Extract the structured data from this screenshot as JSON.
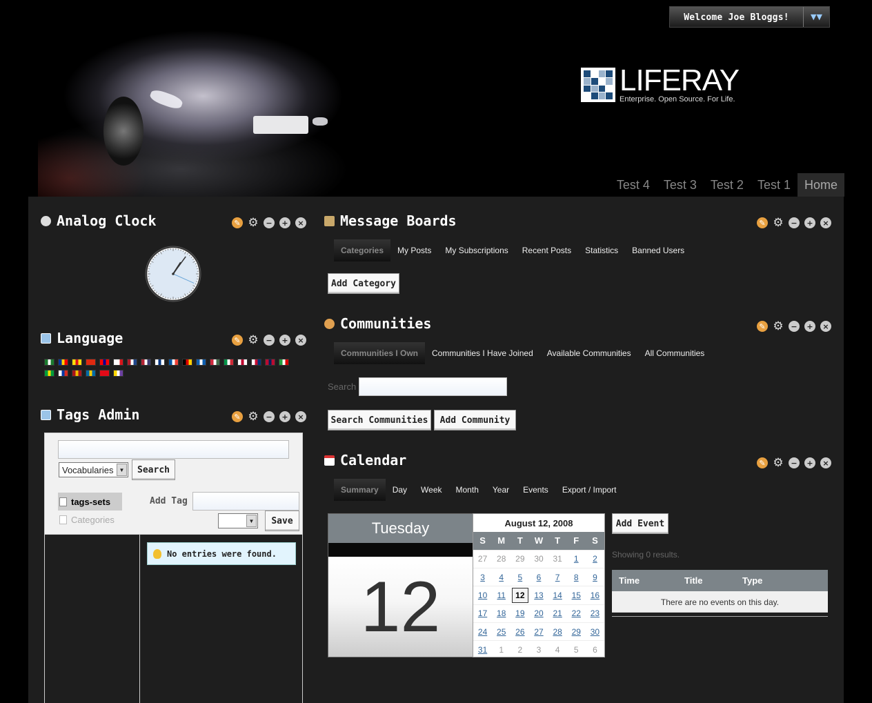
{
  "header": {
    "welcome": "Welcome Joe Bloggs!",
    "logo_word": "LIFERAY",
    "logo_tagline": "Enterprise. Open Source. For Life.",
    "nav": [
      "Test 4",
      "Test 3",
      "Test 2",
      "Test 1",
      "Home"
    ],
    "active_nav": "Home"
  },
  "clock": {
    "title": "Analog Clock",
    "hour": 1,
    "minute": 6,
    "second": 19
  },
  "language": {
    "title": "Language",
    "flags": [
      [
        "#1a7a2e",
        "#fff",
        "#1a7a2e"
      ],
      [
        "#0033a0",
        "#ffd100",
        "#e00"
      ],
      [
        "#fcdd09",
        "#da121a",
        "#fcdd09"
      ],
      [
        "#de2910",
        "#de2910",
        "#de2910"
      ],
      [
        "#fe0000",
        "#000095",
        "#fe0000"
      ],
      [
        "#fff",
        "#fff",
        "#d7141a"
      ],
      [
        "#ae1c28",
        "#fff",
        "#21468b"
      ],
      [
        "#b22234",
        "#fff",
        "#3c3b6e"
      ],
      [
        "#fff",
        "#003580",
        "#fff"
      ],
      [
        "#0055a4",
        "#fff",
        "#ef4135"
      ],
      [
        "#000",
        "#dd0000",
        "#ffce00"
      ],
      [
        "#0d5eaf",
        "#fff",
        "#0d5eaf"
      ],
      [
        "#cd2a3e",
        "#fff",
        "#436f4d"
      ],
      [
        "#009246",
        "#fff",
        "#ce2b37"
      ],
      [
        "#fff",
        "#bc002d",
        "#fff"
      ],
      [
        "#fff",
        "#c60c30",
        "#003478"
      ],
      [
        "#ba0c2f",
        "#00205b",
        "#ba0c2f"
      ],
      [
        "#239f40",
        "#fff",
        "#da0000"
      ],
      [
        "#009c3b",
        "#ffdf00",
        "#009c3b"
      ],
      [
        "#fff",
        "#0039a6",
        "#d52b1e"
      ],
      [
        "#aa151b",
        "#f1bf00",
        "#aa151b"
      ],
      [
        "#006aa7",
        "#fecc00",
        "#006aa7"
      ],
      [
        "#e30a17",
        "#e30a17",
        "#e30a17"
      ],
      [
        "#ffd700",
        "#fff",
        "#6b3fa0"
      ]
    ]
  },
  "tags_admin": {
    "title": "Tags Admin",
    "search_value": "",
    "vocab_select": "Vocabularies",
    "search_btn": "Search",
    "tag_sets": "tags-sets",
    "categories": "Categories",
    "add_tag_label": "Add Tag",
    "add_tag_value": "",
    "small_select": "",
    "save_btn": "Save",
    "no_entries": "No entries were found."
  },
  "message_boards": {
    "title": "Message Boards",
    "tabs": [
      "Categories",
      "My Posts",
      "My Subscriptions",
      "Recent Posts",
      "Statistics",
      "Banned Users"
    ],
    "add_category_btn": "Add Category"
  },
  "communities": {
    "title": "Communities",
    "tabs": [
      "Communities I Own",
      "Communities I Have Joined",
      "Available Communities",
      "All Communities"
    ],
    "search_label": "Search",
    "search_value": "",
    "search_btn": "Search Communities",
    "add_btn": "Add Community"
  },
  "calendar": {
    "title": "Calendar",
    "tabs": [
      "Summary",
      "Day",
      "Week",
      "Month",
      "Year",
      "Events",
      "Export / Import"
    ],
    "day_name": "Tuesday",
    "day_number": "12",
    "month_title": "August 12, 2008",
    "weekdays": [
      "S",
      "M",
      "T",
      "W",
      "T",
      "F",
      "S"
    ],
    "weeks": [
      [
        [
          "27",
          "other"
        ],
        [
          "28",
          "other"
        ],
        [
          "29",
          "other"
        ],
        [
          "30",
          "other"
        ],
        [
          "31",
          "other"
        ],
        [
          "1",
          "cur"
        ],
        [
          "2",
          "cur"
        ]
      ],
      [
        [
          "3",
          "cur"
        ],
        [
          "4",
          "cur"
        ],
        [
          "5",
          "cur"
        ],
        [
          "6",
          "cur"
        ],
        [
          "7",
          "cur"
        ],
        [
          "8",
          "cur"
        ],
        [
          "9",
          "cur"
        ]
      ],
      [
        [
          "10",
          "cur"
        ],
        [
          "11",
          "cur"
        ],
        [
          "12",
          "today"
        ],
        [
          "13",
          "cur"
        ],
        [
          "14",
          "cur"
        ],
        [
          "15",
          "cur"
        ],
        [
          "16",
          "cur"
        ]
      ],
      [
        [
          "17",
          "cur"
        ],
        [
          "18",
          "cur"
        ],
        [
          "19",
          "cur"
        ],
        [
          "20",
          "cur"
        ],
        [
          "21",
          "cur"
        ],
        [
          "22",
          "cur"
        ],
        [
          "23",
          "cur"
        ]
      ],
      [
        [
          "24",
          "cur"
        ],
        [
          "25",
          "cur"
        ],
        [
          "26",
          "cur"
        ],
        [
          "27",
          "cur"
        ],
        [
          "28",
          "cur"
        ],
        [
          "29",
          "cur"
        ],
        [
          "30",
          "cur"
        ]
      ],
      [
        [
          "31",
          "cur"
        ],
        [
          "1",
          "other"
        ],
        [
          "2",
          "other"
        ],
        [
          "3",
          "other"
        ],
        [
          "4",
          "other"
        ],
        [
          "5",
          "other"
        ],
        [
          "6",
          "other"
        ]
      ]
    ],
    "add_event_btn": "Add Event",
    "showing": "Showing 0 results.",
    "columns": [
      "Time",
      "Title",
      "Type"
    ],
    "empty": "There are no events on this day."
  },
  "colors": {
    "page_bg": "#000000",
    "content_bg": "#1e1e1e",
    "header_grey": "#7c8489",
    "link_blue": "#336699"
  }
}
